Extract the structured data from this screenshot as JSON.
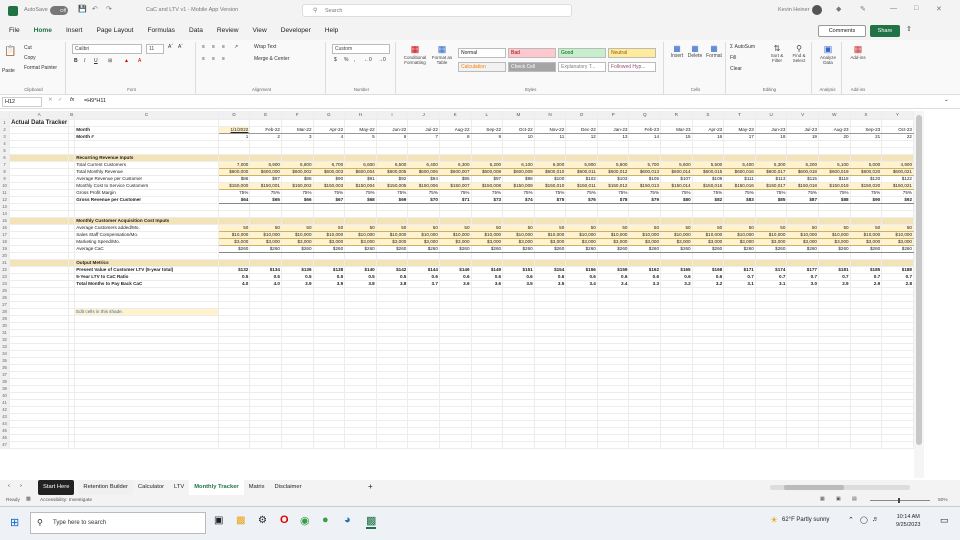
{
  "titlebar": {
    "autosave": "AutoSave",
    "toggle": "Off",
    "filename": "CaC and LTV v1 - Mobile App Version",
    "search": "Search",
    "user": "Kevin Heiner"
  },
  "menu": [
    "File",
    "Home",
    "Insert",
    "Page Layout",
    "Formulas",
    "Data",
    "Review",
    "View",
    "Developer",
    "Help"
  ],
  "menu_active": "Home",
  "comments_label": "Comments",
  "share_label": "Share",
  "ribbon": {
    "clipboard": {
      "paste": "Paste",
      "cut": "Cut",
      "copy": "Copy",
      "format_painter": "Format Painter",
      "label": "Clipboard"
    },
    "font": {
      "name": "Calibri",
      "size": "11",
      "label": "Font"
    },
    "alignment": {
      "wrap": "Wrap Text",
      "merge": "Merge & Center",
      "label": "Alignment"
    },
    "number": {
      "format": "Custom",
      "label": "Number"
    },
    "styles": {
      "conditional": "Conditional Formatting",
      "format_table": "Format as Table",
      "cells": [
        {
          "name": "Normal",
          "bg": "#ffffff",
          "color": "#222222"
        },
        {
          "name": "Bad",
          "bg": "#ffc7ce",
          "color": "#9c0006"
        },
        {
          "name": "Good",
          "bg": "#c6efce",
          "color": "#006100"
        },
        {
          "name": "Neutral",
          "bg": "#ffeb9c",
          "color": "#9c5700"
        },
        {
          "name": "Calculation",
          "bg": "#f2f2f2",
          "color": "#fa7d00"
        },
        {
          "name": "Check Cell",
          "bg": "#a5a5a5",
          "color": "#ffffff"
        },
        {
          "name": "Explanatory T...",
          "bg": "#ffffff",
          "color": "#7f7f7f"
        },
        {
          "name": "Followed Hyp...",
          "bg": "#ffffff",
          "color": "#954f72"
        }
      ],
      "label": "Styles"
    },
    "cells": {
      "insert": "Insert",
      "delete": "Delete",
      "format": "Format",
      "label": "Cells"
    },
    "editing": {
      "autosum": "AutoSum",
      "fill": "Fill",
      "clear": "Clear",
      "sort": "Sort & Filter",
      "find": "Find & Select",
      "label": "Editing"
    },
    "analysis": {
      "analyze": "Analyze Data",
      "label": "Analysis"
    },
    "addins": {
      "addins": "Add-ins",
      "label": "Add-ins"
    }
  },
  "formula": {
    "cell_ref": "H12",
    "fx": "fx",
    "content": "=H9*H11"
  },
  "grid": {
    "col_letters": [
      "A",
      "B",
      "C",
      "D",
      "E",
      "F",
      "G",
      "H",
      "I",
      "J",
      "K",
      "L",
      "M",
      "N",
      "O",
      "P",
      "Q",
      "R",
      "S",
      "T",
      "U",
      "V",
      "W",
      "X",
      "Y"
    ],
    "months": [
      "1/1/2022",
      "Feb-22",
      "Mar-22",
      "Apr-22",
      "May-22",
      "Jun-22",
      "Jul-22",
      "Aug-22",
      "Sep-22",
      "Oct-22",
      "Nov-22",
      "Dec-22",
      "Jan-23",
      "Feb-23",
      "Mar-23",
      "Apr-23",
      "May-23",
      "Jun-23",
      "Jul-23",
      "Aug-23",
      "Sep-23",
      "Oct-23"
    ],
    "month_nums": [
      "1",
      "2",
      "3",
      "4",
      "5",
      "6",
      "7",
      "8",
      "9",
      "10",
      "11",
      "12",
      "13",
      "14",
      "15",
      "16",
      "17",
      "18",
      "19",
      "20",
      "21",
      "22"
    ],
    "rows": [
      {
        "n": 1,
        "label": "Actual Data Tracker",
        "type": "title"
      },
      {
        "n": 2,
        "label": "Month",
        "type": "months"
      },
      {
        "n": 3,
        "label": "Month #",
        "type": "monthnums"
      },
      {
        "n": 4,
        "type": "blank"
      },
      {
        "n": 5,
        "type": "blank"
      },
      {
        "n": 6,
        "label": "Recurring Revenue Inputs",
        "type": "section"
      },
      {
        "n": 7,
        "label": "Total Current Customers",
        "type": "input",
        "values": [
          "7,000",
          "6,900",
          "6,800",
          "6,700",
          "6,600",
          "6,500",
          "6,400",
          "6,300",
          "6,200",
          "6,100",
          "6,000",
          "5,900",
          "5,800",
          "5,700",
          "5,600",
          "5,500",
          "5,400",
          "5,300",
          "5,200",
          "5,100",
          "5,000",
          "4,900"
        ]
      },
      {
        "n": 8,
        "label": "Total Monthly Revenue",
        "type": "input",
        "values": [
          "$600,000",
          "$600,000",
          "$600,002",
          "$600,003",
          "$600,004",
          "$600,005",
          "$600,006",
          "$600,007",
          "$600,008",
          "$600,009",
          "$600,010",
          "$600,011",
          "$600,012",
          "$600,013",
          "$600,014",
          "$600,015",
          "$600,016",
          "$600,017",
          "$600,018",
          "$600,019",
          "$600,020",
          "$600,021"
        ]
      },
      {
        "n": 9,
        "label": "Average Revenue per Customer",
        "type": "data",
        "values": [
          "$86",
          "$87",
          "$88",
          "$90",
          "$91",
          "$92",
          "$94",
          "$95",
          "$97",
          "$98",
          "$100",
          "$102",
          "$103",
          "$105",
          "$107",
          "$109",
          "$111",
          "$113",
          "$115",
          "$118",
          "$120",
          "$122"
        ]
      },
      {
        "n": 10,
        "label": "Monthly Cost to Service Customers",
        "type": "input",
        "values": [
          "$150,000",
          "$150,001",
          "$150,002",
          "$150,003",
          "$150,004",
          "$150,005",
          "$150,006",
          "$150,007",
          "$150,008",
          "$150,009",
          "$150,010",
          "$150,011",
          "$150,012",
          "$150,013",
          "$150,014",
          "$150,015",
          "$150,016",
          "$150,017",
          "$150,018",
          "$150,019",
          "$150,020",
          "$150,021"
        ]
      },
      {
        "n": 11,
        "label": "Gross Profit Margin",
        "type": "data",
        "values": [
          "75%",
          "75%",
          "75%",
          "75%",
          "75%",
          "75%",
          "75%",
          "75%",
          "75%",
          "75%",
          "75%",
          "75%",
          "75%",
          "75%",
          "75%",
          "75%",
          "75%",
          "75%",
          "75%",
          "75%",
          "75%",
          "75%"
        ]
      },
      {
        "n": 12,
        "label": "Gross Revenue per Customer",
        "type": "bolddata",
        "values": [
          "$64",
          "$65",
          "$66",
          "$67",
          "$68",
          "$69",
          "$70",
          "$71",
          "$73",
          "$74",
          "$75",
          "$76",
          "$78",
          "$79",
          "$80",
          "$82",
          "$83",
          "$85",
          "$87",
          "$88",
          "$90",
          "$92"
        ]
      },
      {
        "n": 13,
        "type": "blank"
      },
      {
        "n": 14,
        "type": "blank"
      },
      {
        "n": 15,
        "label": "Monthly Customer Acquisition Cost Inputs",
        "type": "section"
      },
      {
        "n": 16,
        "label": "Average Customers added/Mo.",
        "type": "input",
        "values": [
          "50",
          "50",
          "50",
          "50",
          "50",
          "50",
          "50",
          "50",
          "50",
          "50",
          "50",
          "50",
          "50",
          "50",
          "50",
          "50",
          "50",
          "50",
          "50",
          "50",
          "50",
          "50"
        ]
      },
      {
        "n": 17,
        "label": "Sales Staff Compensation/Mo.",
        "type": "input",
        "values": [
          "$10,000",
          "$10,000",
          "$10,000",
          "$10,000",
          "$10,000",
          "$10,000",
          "$10,000",
          "$10,000",
          "$10,000",
          "$10,000",
          "$10,000",
          "$10,000",
          "$10,000",
          "$10,000",
          "$10,000",
          "$10,000",
          "$10,000",
          "$10,000",
          "$10,000",
          "$10,000",
          "$10,000",
          "$10,000"
        ]
      },
      {
        "n": 18,
        "label": "Marketing Spend/Mo.",
        "type": "input",
        "values": [
          "$3,000",
          "$3,000",
          "$3,000",
          "$3,000",
          "$3,000",
          "$3,000",
          "$3,000",
          "$3,000",
          "$3,000",
          "$3,000",
          "$3,000",
          "$3,000",
          "$3,000",
          "$3,000",
          "$3,000",
          "$3,000",
          "$3,000",
          "$3,000",
          "$3,000",
          "$3,000",
          "$3,000",
          "$3,000"
        ]
      },
      {
        "n": 19,
        "label": "Average CaC",
        "type": "data",
        "values": [
          "$260",
          "$260",
          "$260",
          "$260",
          "$260",
          "$260",
          "$260",
          "$260",
          "$260",
          "$260",
          "$260",
          "$260",
          "$260",
          "$260",
          "$260",
          "$260",
          "$260",
          "$260",
          "$260",
          "$260",
          "$260",
          "$260"
        ]
      },
      {
        "n": 20,
        "type": "blank"
      },
      {
        "n": 21,
        "label": "Output Metrics",
        "type": "section"
      },
      {
        "n": 22,
        "label": "Present Value of Customer LTV (5-year total)",
        "type": "bolddata",
        "values": [
          "$132",
          "$134",
          "$136",
          "$138",
          "$140",
          "$142",
          "$144",
          "$146",
          "$149",
          "$151",
          "$154",
          "$156",
          "$159",
          "$162",
          "$165",
          "$168",
          "$171",
          "$174",
          "$177",
          "$181",
          "$185",
          "$188"
        ]
      },
      {
        "n": 23,
        "label": "5-Year LTV to CaC Ratio",
        "type": "bolddata",
        "values": [
          "0.5",
          "0.5",
          "0.5",
          "0.5",
          "0.5",
          "0.5",
          "0.6",
          "0.6",
          "0.6",
          "0.6",
          "0.6",
          "0.6",
          "0.6",
          "0.6",
          "0.6",
          "0.6",
          "0.7",
          "0.7",
          "0.7",
          "0.7",
          "0.7",
          "0.7"
        ]
      },
      {
        "n": 24,
        "label": "Total Months to Pay Back CaC",
        "type": "bolddata",
        "values": [
          "4.0",
          "4.0",
          "3.9",
          "3.9",
          "3.8",
          "3.8",
          "3.7",
          "3.6",
          "3.6",
          "3.5",
          "3.5",
          "3.4",
          "3.4",
          "3.3",
          "3.2",
          "3.2",
          "3.1",
          "3.1",
          "3.0",
          "2.9",
          "2.9",
          "2.8"
        ]
      },
      {
        "n": 25,
        "type": "blank"
      },
      {
        "n": 26,
        "type": "blank"
      },
      {
        "n": 27,
        "type": "blank"
      },
      {
        "n": 28,
        "label": "Edit cells in this shade.",
        "type": "note"
      },
      {
        "n": 29,
        "type": "blank"
      },
      {
        "n": 30,
        "type": "blank"
      },
      {
        "n": 31,
        "type": "blank"
      },
      {
        "n": 32,
        "type": "blank"
      },
      {
        "n": 33,
        "type": "blank"
      },
      {
        "n": 34,
        "type": "blank"
      },
      {
        "n": 35,
        "type": "blank"
      },
      {
        "n": 36,
        "type": "blank"
      },
      {
        "n": 37,
        "type": "blank"
      },
      {
        "n": 38,
        "type": "blank"
      },
      {
        "n": 39,
        "type": "blank"
      },
      {
        "n": 40,
        "type": "blank"
      },
      {
        "n": 41,
        "type": "blank"
      },
      {
        "n": 42,
        "type": "blank"
      },
      {
        "n": 43,
        "type": "blank"
      },
      {
        "n": 44,
        "type": "blank"
      },
      {
        "n": 45,
        "type": "blank"
      },
      {
        "n": 46,
        "type": "blank"
      },
      {
        "n": 47,
        "type": "blank"
      }
    ]
  },
  "sheets": [
    "Start Here",
    "Retention Builder",
    "Calculator",
    "LTV",
    "Monthly Tracker",
    "Matrix",
    "Disclaimer"
  ],
  "active_sheet": "Monthly Tracker",
  "status": {
    "ready": "Ready",
    "accessibility": "Accessibility: Investigate",
    "zoom": "50%"
  },
  "taskbar": {
    "search_placeholder": "Type here to search",
    "weather": "62°F  Partly sunny",
    "time": "10:14 AM",
    "date": "9/25/2023"
  },
  "colors": {
    "excel_green": "#217346",
    "input_shade": "#fff2cc",
    "section_shade": "#f2e4b8"
  }
}
